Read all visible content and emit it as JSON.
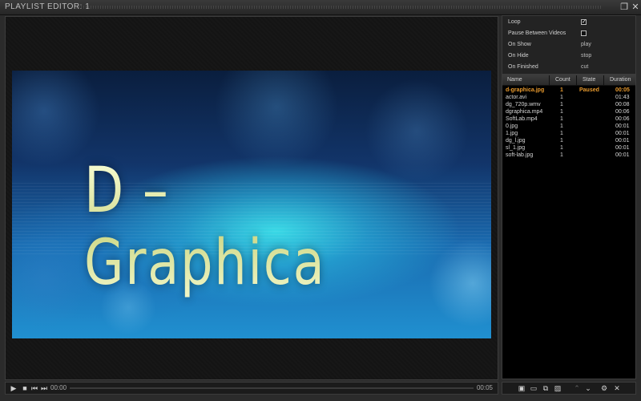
{
  "window": {
    "title": "PLAYLIST EDITOR: 1"
  },
  "window_controls": {
    "restore_icon": "restore-icon",
    "close_icon": "close-icon"
  },
  "video": {
    "title_text": "D – Graphica"
  },
  "transport": {
    "time_current": "00:00",
    "time_total": "00:05",
    "icons": [
      "play-icon",
      "stop-icon",
      "previous-icon",
      "next-icon"
    ]
  },
  "properties": [
    {
      "label": "Loop",
      "type": "checkbox",
      "checked": true
    },
    {
      "label": "Pause Between Videos",
      "type": "checkbox",
      "checked": false
    },
    {
      "label": "On Show",
      "type": "value",
      "value": "play"
    },
    {
      "label": "On Hide",
      "type": "value",
      "value": "stop"
    },
    {
      "label": "On Finished",
      "type": "value",
      "value": "cut"
    }
  ],
  "playlist": {
    "columns": [
      "Name",
      "Count",
      "State",
      "Duration"
    ],
    "rows": [
      {
        "name": "d-graphica.jpg",
        "count": "1",
        "state": "Paused",
        "duration": "00:05",
        "active": true
      },
      {
        "name": "actor.avi",
        "count": "1",
        "state": "",
        "duration": "01:43"
      },
      {
        "name": "dg_720p.wmv",
        "count": "1",
        "state": "",
        "duration": "00:08"
      },
      {
        "name": "dgraphica.mp4",
        "count": "1",
        "state": "",
        "duration": "00:06"
      },
      {
        "name": "SoftLab.mp4",
        "count": "1",
        "state": "",
        "duration": "00:06"
      },
      {
        "name": "0.jpg",
        "count": "1",
        "state": "",
        "duration": "00:01"
      },
      {
        "name": "1.jpg",
        "count": "1",
        "state": "",
        "duration": "00:01"
      },
      {
        "name": "dg_l.jpg",
        "count": "1",
        "state": "",
        "duration": "00:01"
      },
      {
        "name": "sl_1.jpg",
        "count": "1",
        "state": "",
        "duration": "00:01"
      },
      {
        "name": "soft-lab.jpg",
        "count": "1",
        "state": "",
        "duration": "00:01"
      }
    ]
  },
  "toolbar": {
    "icons": [
      "add-clip-icon",
      "add-video-icon",
      "add-copy-icon",
      "add-image-icon",
      "move-up-icon",
      "move-down-icon",
      "settings-icon",
      "remove-icon"
    ],
    "accent_color": "#e89a2e"
  }
}
